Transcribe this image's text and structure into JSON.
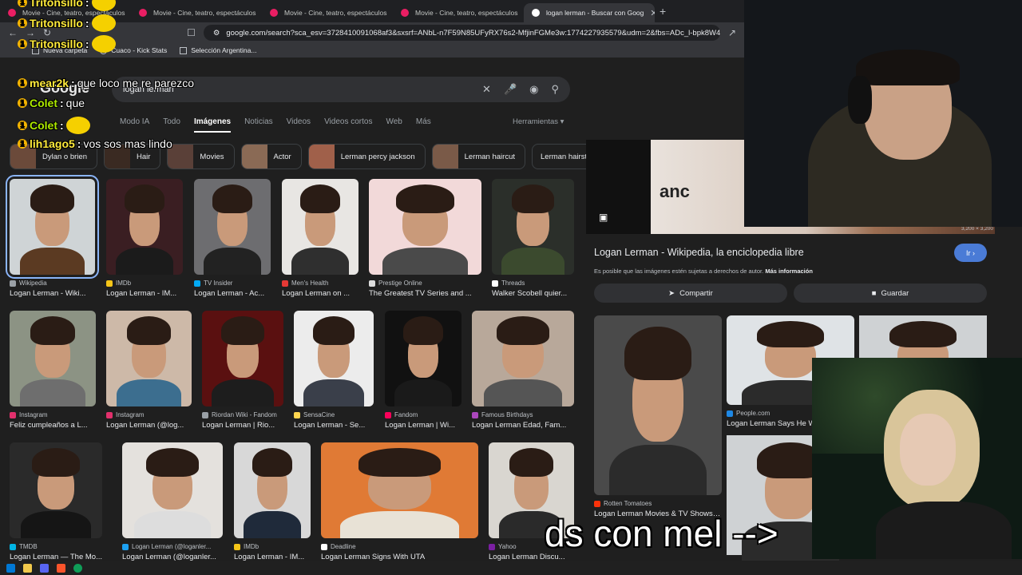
{
  "browser": {
    "tabs": [
      {
        "title": "Movie - Cine, teatro, espectáculos",
        "active": false
      },
      {
        "title": "Movie - Cine, teatro, espectáculos",
        "active": false
      },
      {
        "title": "Movie - Cine, teatro, espectáculos",
        "active": false
      },
      {
        "title": "Movie - Cine, teatro, espectáculos",
        "active": false
      },
      {
        "title": "logan lerman - Buscar con Goog",
        "active": true
      }
    ],
    "url": "google.com/search?sca_esv=3728410091068af3&sxsrf=ANbL-n7F59N85UFyRX76s2-MfjinFGMe3w:1774227935579&udm=2&fbs=ADc_l-bpk8W4E-q...",
    "bookmarks": [
      "Nueva carpeta",
      "Cuaco - Kick Stats",
      "Selección Argentina..."
    ]
  },
  "google": {
    "logo": "Google",
    "query": "logan lerman",
    "tabs": [
      "Modo IA",
      "Todo",
      "Imágenes",
      "Noticias",
      "Videos",
      "Videos cortos",
      "Web",
      "Más"
    ],
    "active_tab": "Imágenes",
    "tools": "Herramientas",
    "chips": [
      "Dylan o brien",
      "Hair",
      "Movies",
      "Actor",
      "Lerman percy jackson",
      "Lerman haircut",
      "Lerman hairstyle"
    ],
    "results": [
      {
        "source": "Wikipedia",
        "title": "Logan Lerman - Wiki...",
        "bg": "#cfd4d6",
        "shirt": "#5b3a22",
        "fav": "#9aa0a6"
      },
      {
        "source": "IMDb",
        "title": "Logan Lerman - IM...",
        "bg": "#3a1e22",
        "shirt": "#1b1b1b",
        "fav": "#f5c518"
      },
      {
        "source": "TV Insider",
        "title": "Logan Lerman - Ac...",
        "bg": "#6d6d70",
        "shirt": "#222",
        "fav": "#03a9f4"
      },
      {
        "source": "Men's Health",
        "title": "Logan Lerman on ...",
        "bg": "#e8e6e3",
        "shirt": "#2f2f2f",
        "fav": "#e53935"
      },
      {
        "source": "Prestige Online",
        "title": "The Greatest TV Series and ...",
        "bg": "#f2d9d9",
        "shirt": "#4a4a4a",
        "fav": "#ddd"
      },
      {
        "source": "Threads",
        "title": "Walker Scobell quier...",
        "bg": "#2b2f2a",
        "shirt": "#3b4a2e",
        "fav": "#fff"
      },
      {
        "source": "Instagram",
        "title": "Feliz cumpleaños a L...",
        "bg": "#8c9384",
        "shirt": "#6e6e6e",
        "fav": "#e1306c"
      },
      {
        "source": "Instagram",
        "title": "Logan Lerman (@log...",
        "bg": "#cdb9a8",
        "shirt": "#3c6e8f",
        "fav": "#e1306c"
      },
      {
        "source": "Riordan Wiki - Fandom",
        "title": "Logan Lerman | Rio...",
        "bg": "#5a1010",
        "shirt": "#1d1d1d",
        "fav": "#9aa0a6"
      },
      {
        "source": "SensaCine",
        "title": "Logan Lerman - Se...",
        "bg": "#ececec",
        "shirt": "#3a3f4a",
        "fav": "#ffd54f"
      },
      {
        "source": "Fandom",
        "title": "Logan Lerman | Wi...",
        "bg": "#111",
        "shirt": "#1a1a1a",
        "fav": "#fa005a"
      },
      {
        "source": "Famous Birthdays",
        "title": "Logan Lerman Edad, Fam...",
        "bg": "#b8a89a",
        "shirt": "#555",
        "fav": "#ab47bc"
      },
      {
        "source": "TMDB",
        "title": "Logan Lerman — The Mo...",
        "bg": "#2a2a2a",
        "shirt": "#151515",
        "fav": "#01b4e4"
      },
      {
        "source": "Logan Lerman (@loganler...",
        "title": "Logan Lerman (@loganler...",
        "bg": "#e4e1dd",
        "shirt": "#ddd",
        "fav": "#1da1f2"
      },
      {
        "source": "IMDb",
        "title": "Logan Lerman - IM...",
        "bg": "#d8d8d8",
        "shirt": "#1f2a3a",
        "fav": "#f5c518"
      },
      {
        "source": "Deadline",
        "title": "Logan Lerman Signs With UTA",
        "bg": "#e07a35",
        "shirt": "#e8e2d6",
        "fav": "#fff"
      },
      {
        "source": "Yahoo",
        "title": "Logan Lerman Discu...",
        "bg": "#d9d6d0",
        "shirt": "#2a2a2a",
        "fav": "#7b1fa2"
      }
    ]
  },
  "panel": {
    "hero_text": "anc",
    "dimensions": "3,200 × 3,200",
    "title": "Logan Lerman - Wikipedia, la enciclopedia libre",
    "go": "Ir",
    "copyright": "Es posible que las imágenes estén sujetas a derechos de autor.",
    "more_info": "Más información",
    "share": "Compartir",
    "save": "Guardar",
    "related": [
      {
        "source": "Rotten Tomatoes",
        "title": "Logan Lerman Movies & TV Shows List |...",
        "bg": "#4a4a4a",
        "fav": "#fa320a"
      },
      {
        "source": "People.com",
        "title": "Logan Lerman Says He Woul...",
        "bg": "#dfe3e6",
        "fav": "#1e88e5"
      }
    ]
  },
  "stream": {
    "chat": [
      {
        "user": "Tritonsillo",
        "message": ""
      },
      {
        "user": "Tritonsillo",
        "message": ""
      },
      {
        "user": "Tritonsillo",
        "message": ""
      },
      {
        "user": "mear2k",
        "message": "que loco me re parezco"
      },
      {
        "user": "Colet",
        "message": "que"
      },
      {
        "user": "Colet",
        "message": ""
      },
      {
        "user": "lih1ago5",
        "message": "vos sos mas lindo"
      }
    ],
    "caption": "ds con mel -->"
  }
}
